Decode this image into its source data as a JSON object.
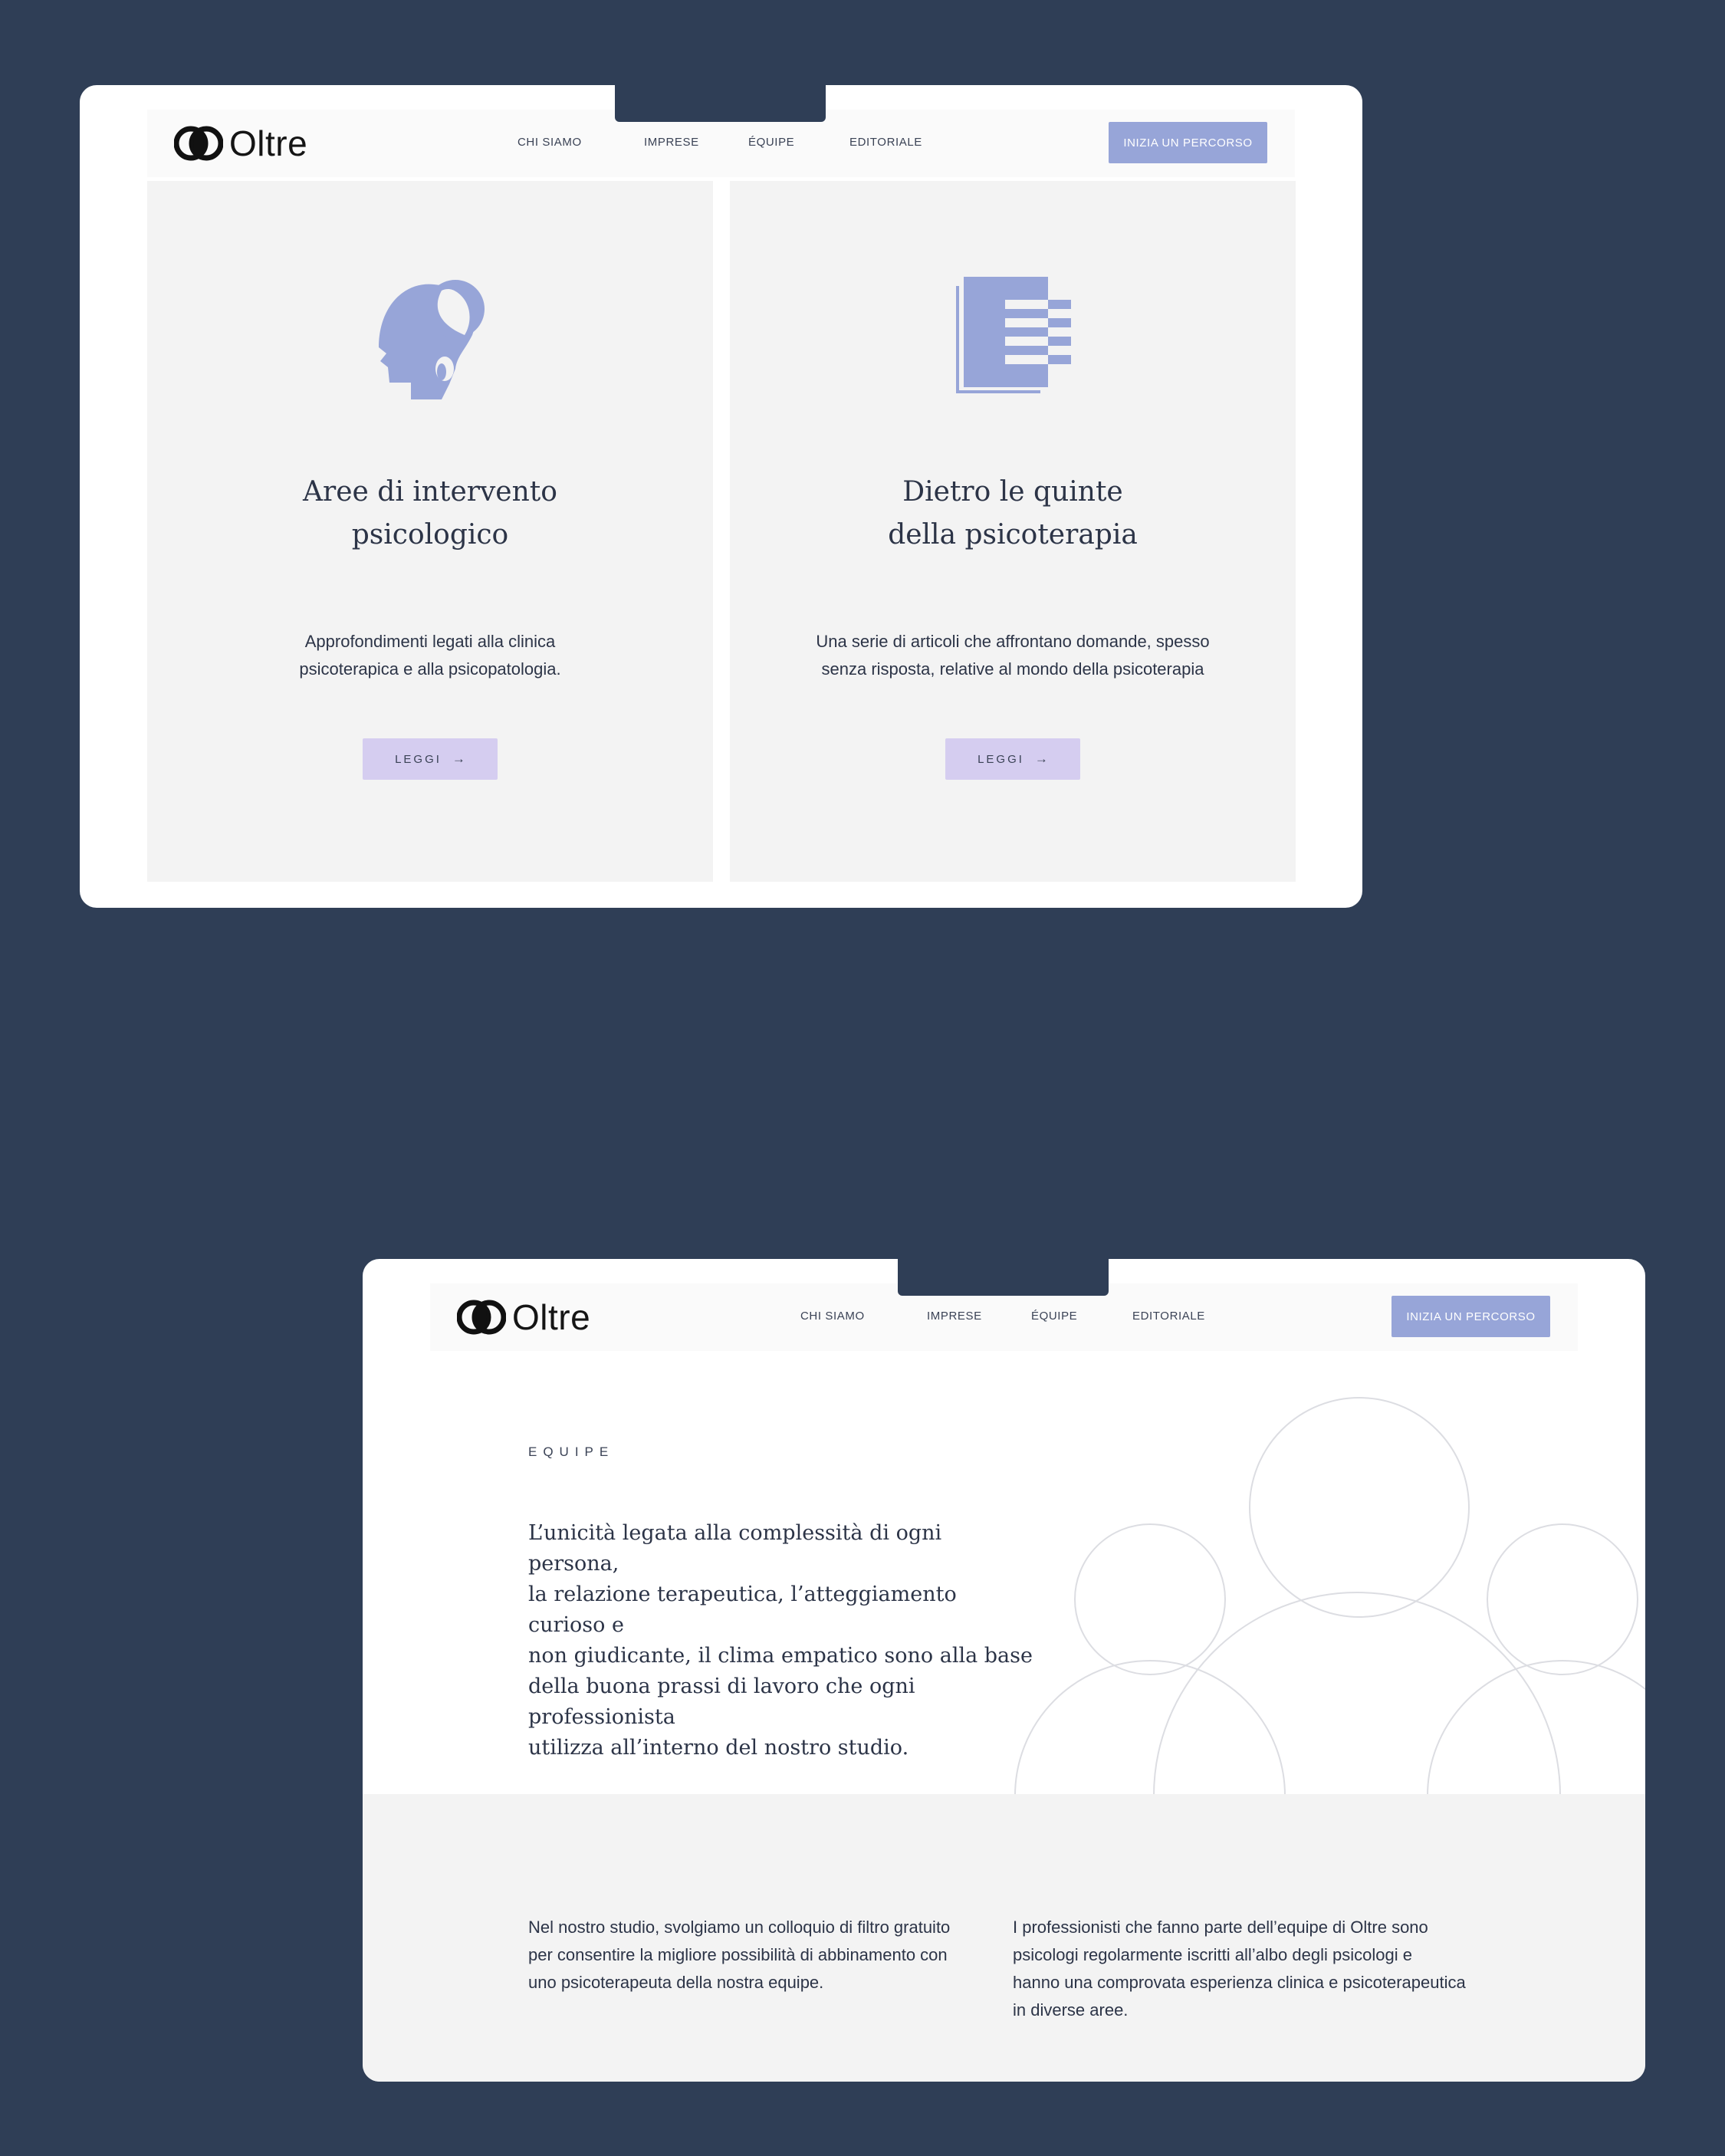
{
  "brand": {
    "name": "Oltre"
  },
  "nav": {
    "items": [
      "CHI SIAMO",
      "IMPRESE",
      "ÉQUIPE",
      "EDITORIALE"
    ],
    "cta": "INIZIA UN PERCORSO"
  },
  "editorial": {
    "cards": [
      {
        "title": "Aree di intervento\npsicologico",
        "description": "Approfondimenti legati alla clinica\npsicoterapica e alla psicopatologia.",
        "button": "LEGGI",
        "icon": "head-thought-icon"
      },
      {
        "title": "Dietro le quinte\ndella psicoterapia",
        "description": "Una serie di articoli che affrontano domande, spesso\nsenza risposta, relative al mondo della psicoterapia",
        "button": "LEGGI",
        "icon": "document-stack-icon"
      }
    ],
    "arrow": "→"
  },
  "equipe": {
    "eyebrow": "EQUIPE",
    "lead": "L’unicità legata alla complessità di ogni persona,\nla relazione terapeutica, l’atteggiamento curioso e\nnon giudicante, il clima empatico sono alla base\ndella buona prassi di lavoro che ogni professionista\nutilizza all’interno del nostro studio.",
    "columns": [
      "Nel nostro studio, svolgiamo un colloquio di filtro gratuito\nper consentire la migliore possibilità di abbinamento con\nuno psicoterapeuta della nostra equipe.",
      "I professionisti che fanno parte dell’equipe di Oltre sono\npsicologi regolarmente iscritti all’albo degli psicologi e\nhanno una comprovata esperienza clinica e psicoterapeutica\nin diverse aree."
    ]
  },
  "colors": {
    "background": "#2f3e56",
    "accent": "#97a5d8",
    "button": "#d5cdf0",
    "panel": "#f3f3f3"
  }
}
